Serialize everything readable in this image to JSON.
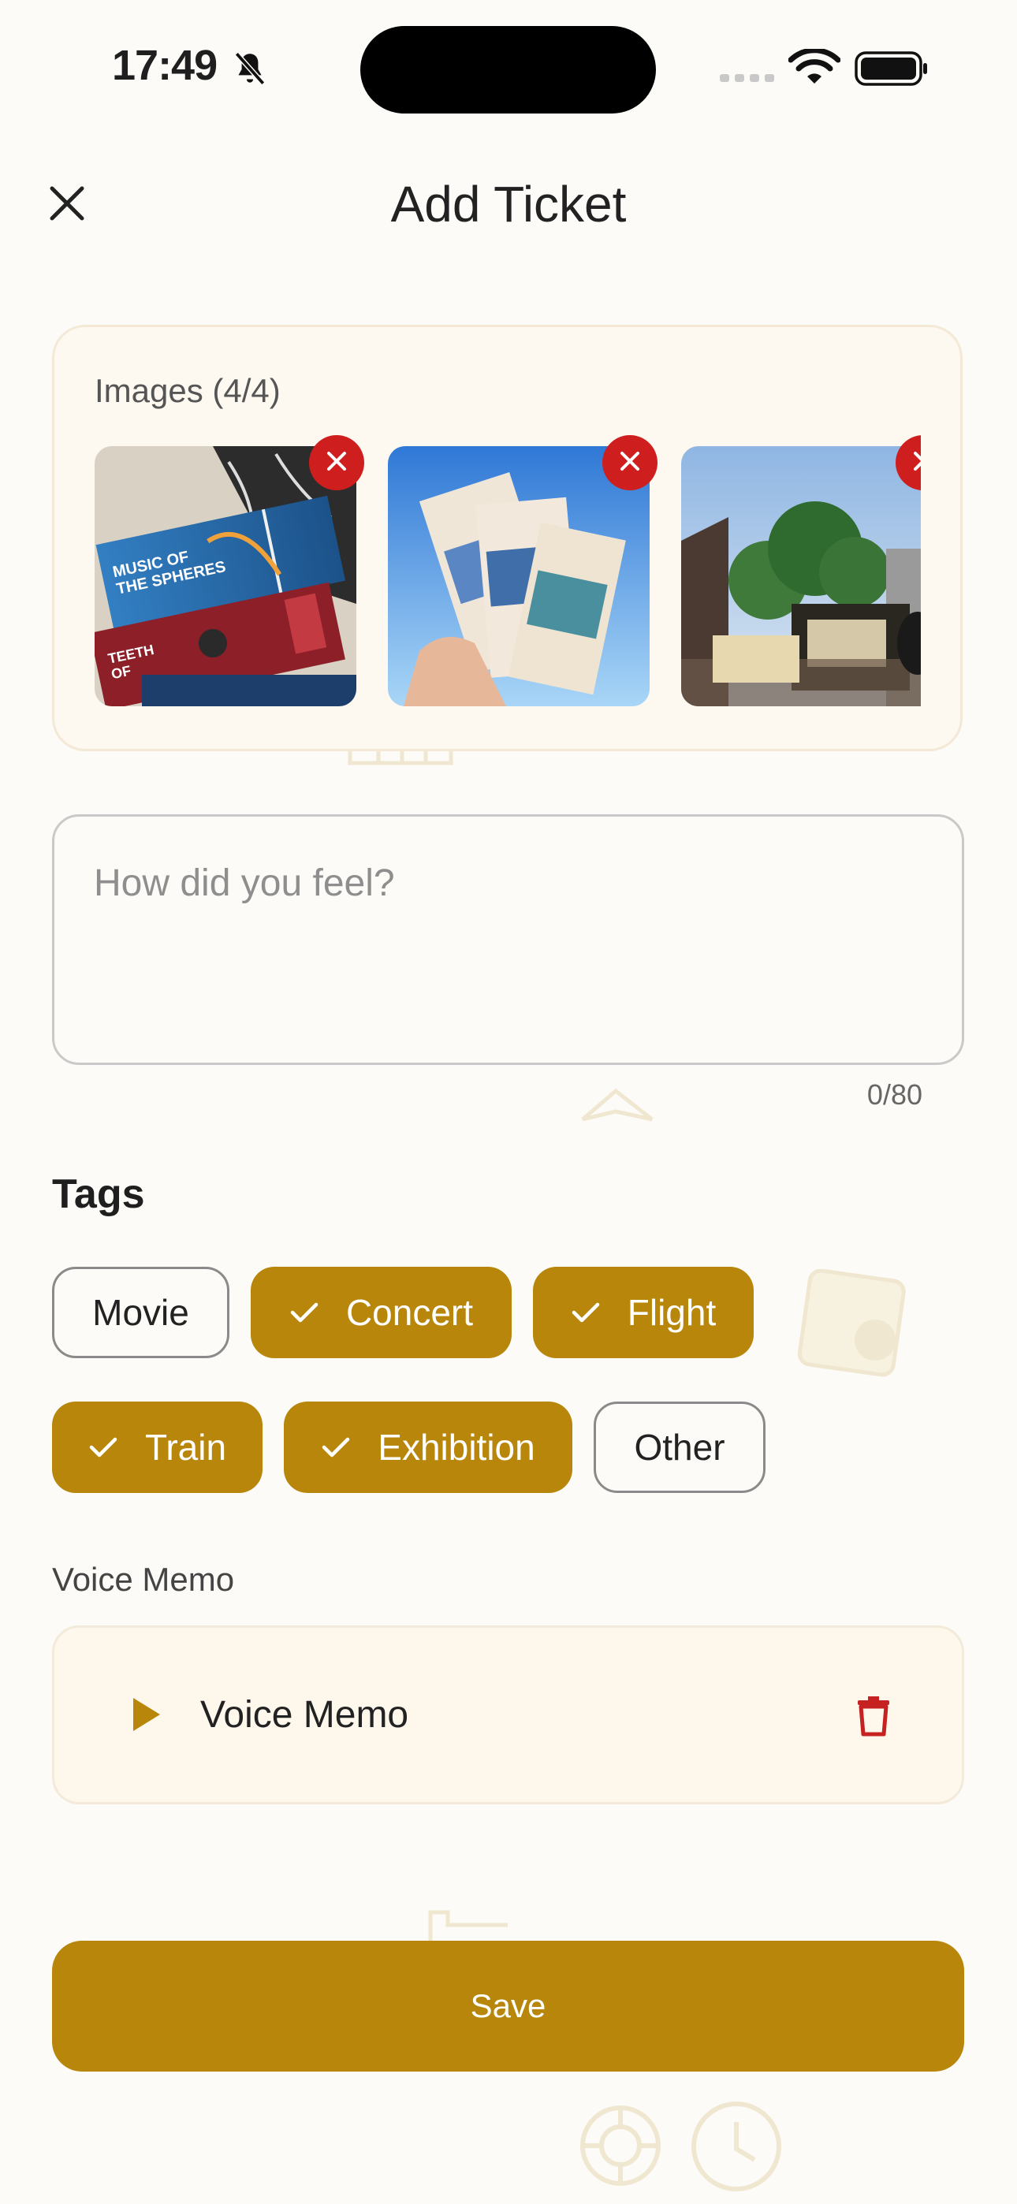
{
  "status_bar": {
    "time": "17:49",
    "icons": [
      "bell-slash-icon",
      "signal-icon",
      "wifi-icon",
      "battery-icon"
    ]
  },
  "header": {
    "title": "Add Ticket",
    "close_icon": "close-icon"
  },
  "images": {
    "label": "Images (4/4)",
    "count": 4,
    "max": 4,
    "thumbnails": [
      {
        "subject": "concert tickets photo",
        "remove_icon": "close-icon"
      },
      {
        "subject": "tickets held against blue sky",
        "remove_icon": "close-icon"
      },
      {
        "subject": "ticket in front of tree and building",
        "remove_icon": "close-icon"
      }
    ]
  },
  "feeling": {
    "placeholder": "How did you feel?",
    "value": "",
    "counter": "0/80"
  },
  "tags": {
    "title": "Tags",
    "items": [
      {
        "label": "Movie",
        "selected": false
      },
      {
        "label": "Concert",
        "selected": true
      },
      {
        "label": "Flight",
        "selected": true
      },
      {
        "label": "Train",
        "selected": true
      },
      {
        "label": "Exhibition",
        "selected": true
      },
      {
        "label": "Other",
        "selected": false
      }
    ]
  },
  "voice_memo": {
    "section_label": "Voice Memo",
    "item_label": "Voice Memo",
    "play_icon": "play-icon",
    "delete_icon": "trash-icon"
  },
  "actions": {
    "save_label": "Save"
  },
  "colors": {
    "accent": "#b8860b",
    "danger": "#cf1e1e",
    "background": "#fcfbf7",
    "card": "#fdf8f0"
  }
}
